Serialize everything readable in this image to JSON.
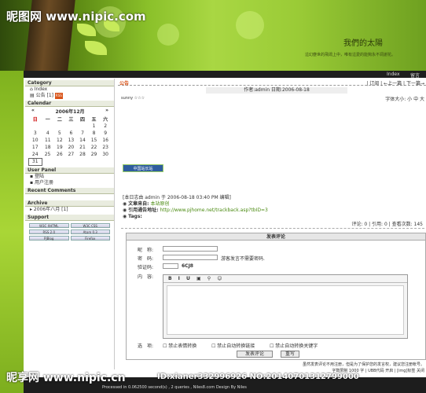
{
  "watermark": {
    "top": "昵图网 www.nipic.com",
    "bottom": "昵享网 www.nipic.cn",
    "bottom_id": "ID:xianer332996926 NO:20140701312799000"
  },
  "site": {
    "title": "我們的太陽",
    "subtitle": "這幻塵世的飛鴿上中，唯有這愛的能夠永不凋謝花。"
  },
  "nav": {
    "index": "Index",
    "logbook": "留言"
  },
  "sidebar": {
    "category_title": "Category",
    "category_items": [
      {
        "label": "Index"
      },
      {
        "label": "公告 [1]",
        "badge": "RSS"
      }
    ],
    "calendar_title": "Calendar",
    "calendar_month": "2006年12月",
    "calendar_prev": "«",
    "calendar_next": "»",
    "weekdays": [
      "日",
      "一",
      "二",
      "三",
      "四",
      "五",
      "六"
    ],
    "weeks": [
      [
        "",
        "",
        "",
        "",
        "",
        "1",
        "2"
      ],
      [
        "3",
        "4",
        "5",
        "6",
        "7",
        "8",
        "9"
      ],
      [
        "10",
        "11",
        "12",
        "13",
        "14",
        "15",
        "16"
      ],
      [
        "17",
        "18",
        "19",
        "20",
        "21",
        "22",
        "23"
      ],
      [
        "24",
        "25",
        "26",
        "27",
        "28",
        "29",
        "30"
      ],
      [
        "31",
        "",
        "",
        "",
        "",
        "",
        ""
      ]
    ],
    "userpanel_title": "User Panel",
    "userpanel_items": [
      "登陆",
      "用户注册"
    ],
    "recent_title": "Recent Comments",
    "archive_title": "Archive",
    "archive_items": [
      "2006年八月 [1]"
    ],
    "support_title": "Support",
    "support_badges": [
      "W3C XHTML",
      "W3C CSS",
      "RSS 2.0",
      "Atom 0.3",
      "PJBlog",
      "Firefox"
    ]
  },
  "main": {
    "title": "公告",
    "top_right": "| 订阅 | ←上一篇 | 下一篇→",
    "meta": "作者:admin 日期:2006-08-18",
    "font_size": "字体大小: 小 中 大",
    "author_line": "sunny ☆☆☆",
    "cn_badge": "中国站长站",
    "post_info": "[本日志由 admin 于 2006-08-18 03:40 PM 编辑]",
    "source_label": "文章来自:",
    "source_value": "本站原创",
    "trackback_label": "引用通告地址:",
    "trackback_value": "http://www.pjhome.net/trackback.asp?tbID=3",
    "tags_label": "Tags:",
    "stats": "评论: 0 | 引用: 0 | 查看次数: 145"
  },
  "form": {
    "header": "发表评论",
    "nickname_label": "昵　称:",
    "password_label": "密　码:",
    "password_hint": "游客发言不需要密码.",
    "captcha_label": "验证码:",
    "captcha_value": "6CJ8",
    "content_label": "内　容:",
    "toolbar": "B I U",
    "options_label": "选　项:",
    "options": [
      "禁止表情转换",
      "禁止自动转换链接",
      "禁止自动转换关键字"
    ],
    "submit": "发表评论",
    "reset": "重写",
    "note": "虽然发表评论不用注册，但是为了保护您的发言权，建议您注册帐号。",
    "limits": "字数限制 1000 字 | UBB代码 开启 | [img]标签 关闭"
  },
  "footer": {
    "processed": "Processed in 0.062500 second(s) , 2 queries , Niles8.com Design By Niles"
  },
  "colors": {
    "accent": "#8bc12a",
    "dark": "#1e1e1e",
    "orange": "#d9551b"
  }
}
